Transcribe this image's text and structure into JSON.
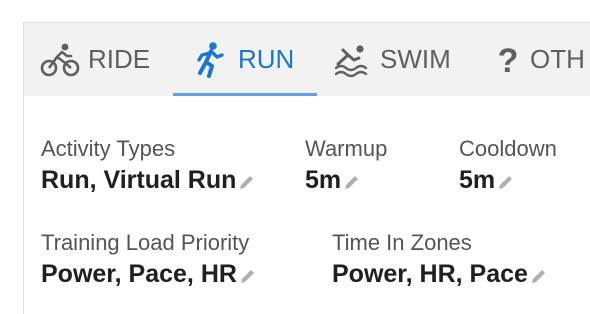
{
  "tabs": [
    {
      "label": "RIDE",
      "icon": "bike-icon",
      "active": false
    },
    {
      "label": "RUN",
      "icon": "run-icon",
      "active": true
    },
    {
      "label": "SWIM",
      "icon": "swim-icon",
      "active": false
    },
    {
      "label": "OTH",
      "icon": "question-icon",
      "active": false
    }
  ],
  "fields": {
    "activity_types": {
      "label": "Activity Types",
      "value": "Run, Virtual Run"
    },
    "warmup": {
      "label": "Warmup",
      "value": "5m"
    },
    "cooldown": {
      "label": "Cooldown",
      "value": "5m"
    },
    "training_load_priority": {
      "label": "Training Load Priority",
      "value": "Power, Pace, HR"
    },
    "time_in_zones": {
      "label": "Time In Zones",
      "value": "Power, HR, Pace"
    }
  },
  "colors": {
    "accent": "#1976d2",
    "tab_bar_bg": "#f2f2f2",
    "inactive_tab": "#5f5f5f",
    "edit_icon": "#b0b0b0"
  }
}
